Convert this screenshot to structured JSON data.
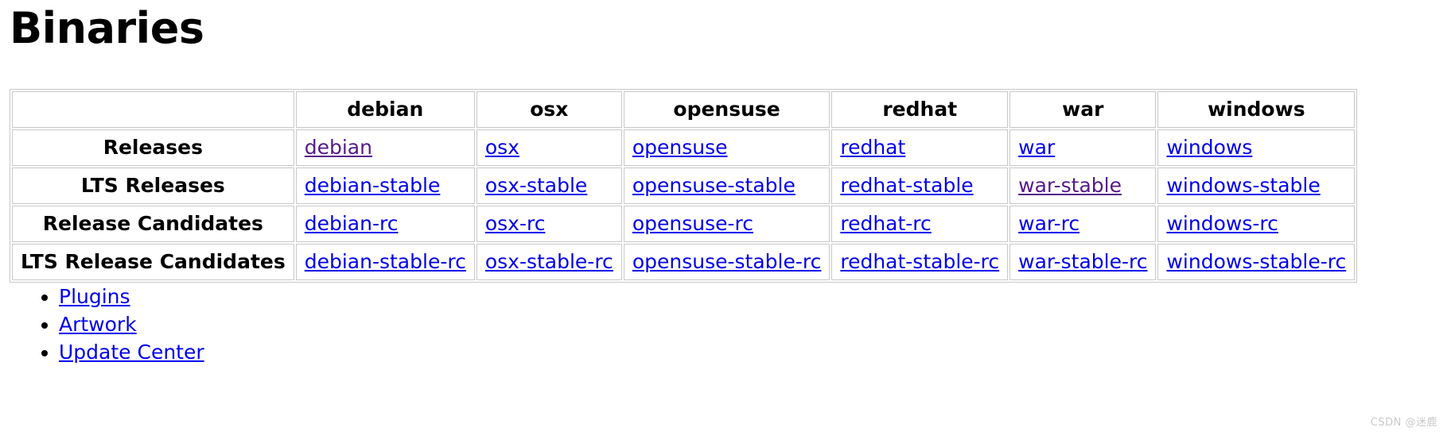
{
  "page": {
    "title": "Binaries"
  },
  "table": {
    "corner_label": "",
    "columns": [
      "debian",
      "osx",
      "opensuse",
      "redhat",
      "war",
      "windows"
    ],
    "rows": [
      {
        "label": "Releases",
        "cells": [
          {
            "text": "debian",
            "visited": true
          },
          {
            "text": "osx",
            "visited": false
          },
          {
            "text": "opensuse",
            "visited": false
          },
          {
            "text": "redhat",
            "visited": false
          },
          {
            "text": "war",
            "visited": false
          },
          {
            "text": "windows",
            "visited": false
          }
        ]
      },
      {
        "label": "LTS Releases",
        "cells": [
          {
            "text": "debian-stable",
            "visited": false
          },
          {
            "text": "osx-stable",
            "visited": false
          },
          {
            "text": "opensuse-stable",
            "visited": false
          },
          {
            "text": "redhat-stable",
            "visited": false
          },
          {
            "text": "war-stable",
            "visited": true
          },
          {
            "text": "windows-stable",
            "visited": false
          }
        ]
      },
      {
        "label": "Release Candidates",
        "cells": [
          {
            "text": "debian-rc",
            "visited": false
          },
          {
            "text": "osx-rc",
            "visited": false
          },
          {
            "text": "opensuse-rc",
            "visited": false
          },
          {
            "text": "redhat-rc",
            "visited": false
          },
          {
            "text": "war-rc",
            "visited": false
          },
          {
            "text": "windows-rc",
            "visited": false
          }
        ]
      },
      {
        "label": "LTS Release Candidates",
        "cells": [
          {
            "text": "debian-stable-rc",
            "visited": false
          },
          {
            "text": "osx-stable-rc",
            "visited": false
          },
          {
            "text": "opensuse-stable-rc",
            "visited": false
          },
          {
            "text": "redhat-stable-rc",
            "visited": false
          },
          {
            "text": "war-stable-rc",
            "visited": false
          },
          {
            "text": "windows-stable-rc",
            "visited": false
          }
        ]
      }
    ]
  },
  "links": [
    {
      "text": "Plugins"
    },
    {
      "text": "Artwork"
    },
    {
      "text": "Update Center"
    }
  ],
  "watermark": {
    "text": "CSDN @迷鹿"
  },
  "colors": {
    "link": "#0000ee",
    "visited_link": "#551a8b",
    "border": "#c8c8c8",
    "text": "#000000",
    "watermark": "#c9c9c9"
  }
}
